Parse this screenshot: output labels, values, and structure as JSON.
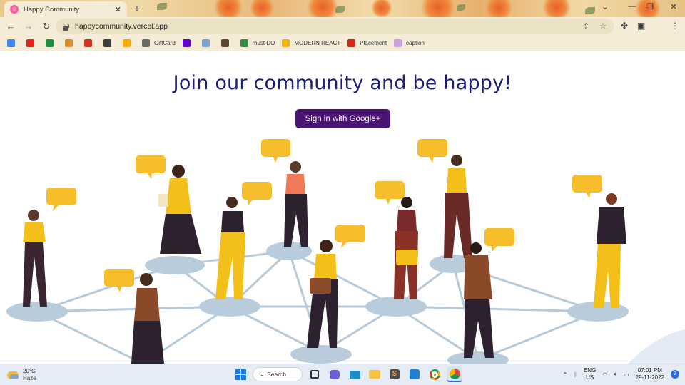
{
  "browser": {
    "tab_title": "Happy Community",
    "tab_favicon": "smiley-icon",
    "url": "happycommunity.vercel.app",
    "bookmarks": [
      {
        "label": "",
        "icon": "google-icon",
        "color": "#4285f4"
      },
      {
        "label": "",
        "icon": "youtube-icon",
        "color": "#e62117"
      },
      {
        "label": "",
        "icon": "classroom-icon",
        "color": "#1e8e3e"
      },
      {
        "label": "",
        "icon": "bookmark-icon",
        "color": "#e08a2c"
      },
      {
        "label": "",
        "icon": "gmail-icon",
        "color": "#d93025"
      },
      {
        "label": "",
        "icon": "cc-icon",
        "color": "#3c4043"
      },
      {
        "label": "",
        "icon": "chart-icon",
        "color": "#f9ab00"
      },
      {
        "label": "GiftCard",
        "icon": "globe-icon",
        "color": "#6b6b6b"
      },
      {
        "label": "",
        "icon": "yahoo-icon",
        "color": "#6001d2"
      },
      {
        "label": "",
        "icon": "cloud-icon",
        "color": "#7aa2d8"
      },
      {
        "label": "",
        "icon": "codechef-icon",
        "color": "#5b4638"
      },
      {
        "label": "must DO",
        "icon": "gfg-icon",
        "color": "#2f8d46"
      },
      {
        "label": "MODERN REACT",
        "icon": "drive-icon",
        "color": "#f4b400"
      },
      {
        "label": "Placement",
        "icon": "youtube-icon",
        "color": "#e62117"
      },
      {
        "label": "caption",
        "icon": "page-icon",
        "color": "#c9a0dc"
      }
    ]
  },
  "page": {
    "headline": "Join our community and be happy!",
    "signin_label": "Sign in with Google+",
    "signin_color": "#4a1570",
    "headline_color": "#1a1f7a"
  },
  "taskbar": {
    "weather_temp": "20°C",
    "weather_desc": "Haze",
    "search_label": "Search",
    "lang_line1": "ENG",
    "lang_line2": "US",
    "time": "07:01 PM",
    "date": "29-11-2022",
    "notification_count": "2"
  }
}
